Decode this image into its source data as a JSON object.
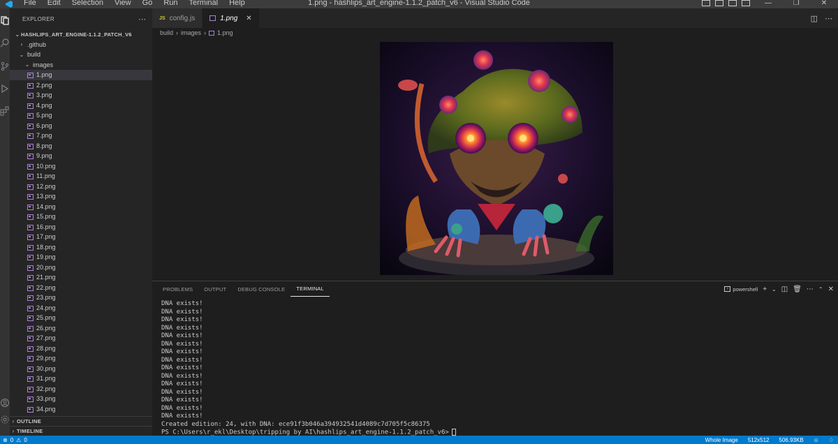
{
  "titlebar": {
    "menu": [
      "File",
      "Edit",
      "Selection",
      "View",
      "Go",
      "Run",
      "Terminal",
      "Help"
    ],
    "title": "1.png - hashlips_art_engine-1.1.2_patch_v6 - Visual Studio Code"
  },
  "sidebar": {
    "header": "EXPLORER",
    "root": "HASHLIPS_ART_ENGINE-1.1.2_PATCH_V6",
    "folders": {
      "github": ".github",
      "build": "build",
      "images": "images"
    },
    "files": [
      "1.png",
      "2.png",
      "3.png",
      "4.png",
      "5.png",
      "6.png",
      "7.png",
      "8.png",
      "9.png",
      "10.png",
      "11.png",
      "12.png",
      "13.png",
      "14.png",
      "15.png",
      "16.png",
      "17.png",
      "18.png",
      "19.png",
      "20.png",
      "21.png",
      "22.png",
      "23.png",
      "24.png",
      "25.png",
      "26.png",
      "27.png",
      "28.png",
      "29.png",
      "30.png",
      "31.png",
      "32.png",
      "33.png",
      "34.png"
    ],
    "selected_file": "1.png",
    "sections": {
      "outline": "OUTLINE",
      "timeline": "TIMELINE"
    }
  },
  "tabs": [
    {
      "badge": "JS",
      "label": "config.js",
      "active": false
    },
    {
      "badge": "img",
      "label": "1.png",
      "active": true
    }
  ],
  "breadcrumb": [
    "build",
    "images",
    "1.png"
  ],
  "panel": {
    "tabs": [
      "PROBLEMS",
      "OUTPUT",
      "DEBUG CONSOLE",
      "TERMINAL"
    ],
    "active_tab": "TERMINAL",
    "shell": "powershell",
    "terminal_lines": [
      "DNA exists!",
      "DNA exists!",
      "DNA exists!",
      "DNA exists!",
      "DNA exists!",
      "DNA exists!",
      "DNA exists!",
      "DNA exists!",
      "DNA exists!",
      "DNA exists!",
      "DNA exists!",
      "DNA exists!",
      "DNA exists!",
      "DNA exists!",
      "DNA exists!",
      "Created edition: 24, with DNA: ece91f3b046a394932541d4089c7d705f5c86375"
    ],
    "prompt": "PS C:\\Users\\r_ekl\\Desktop\\tripping by AI\\hashlips_art_engine-1.1.2_patch_v6>"
  },
  "statusbar": {
    "errors": "0",
    "warnings": "0",
    "view_mode": "Whole Image",
    "dimensions": "512x512",
    "file_size": "506.93KB"
  },
  "colors": {
    "accent": "#007acc",
    "activity_bar": "#333333",
    "sidebar": "#252526",
    "editor": "#1e1e1e"
  }
}
